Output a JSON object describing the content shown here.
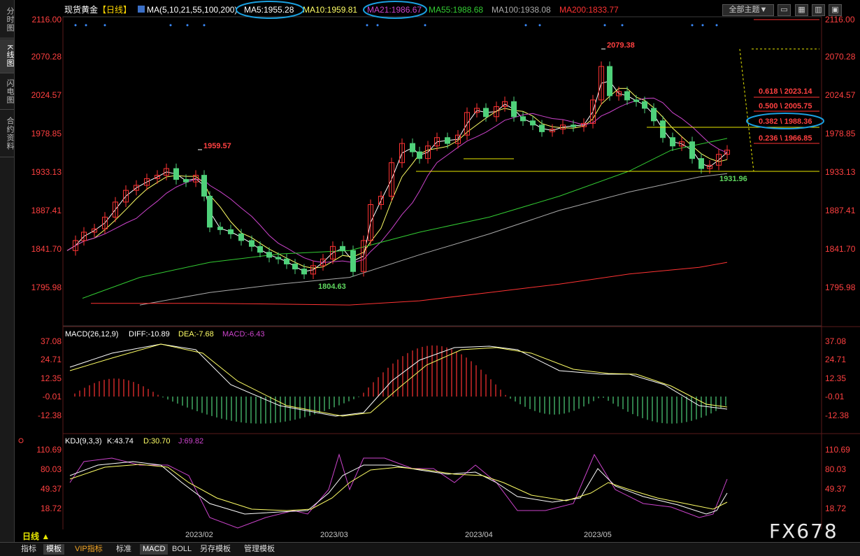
{
  "sidebar": {
    "items": [
      {
        "label": "分时图",
        "active": false
      },
      {
        "label": "K线图",
        "active": true
      },
      {
        "label": "闪电图",
        "active": false
      },
      {
        "label": "合约资料",
        "active": false
      }
    ]
  },
  "header": {
    "symbol": "现货黄金",
    "period_tag": "【日线】",
    "ma_params": "MA(5,10,21,55,100,200)",
    "ma5": "MA5:1955.28",
    "ma10": "MA10:1959.81",
    "ma21": "MA21:1986.67",
    "ma55": "MA55:1988.68",
    "ma100": "MA100:1938.08",
    "ma200": "MA200:1833.77",
    "theme_button": "全部主题▼",
    "colors": {
      "ma5": "#ffffff",
      "ma10": "#ffff66",
      "ma21": "#cc44cc",
      "ma55": "#33cc33",
      "ma100": "#aaaaaa",
      "ma200": "#ff3333"
    }
  },
  "price_axis": {
    "ticks": [
      "2116.00",
      "2070.28",
      "2024.57",
      "1978.85",
      "1933.13",
      "1887.41",
      "1841.70",
      "1795.98"
    ]
  },
  "annotations": {
    "high_label": "2079.38",
    "peak1_label": "1959.57",
    "low_label": "1804.63",
    "recent_low_label": "1931.96",
    "fib": [
      "0.618 \\ 2023.14",
      "0.500 \\ 2005.75",
      "0.382 \\ 1988.36",
      "0.236 \\ 1966.85"
    ]
  },
  "macd": {
    "title": "MACD(26,12,9)",
    "diff": "DIFF:-10.89",
    "dea": "DEA:-7.68",
    "macd": "MACD:-6.43",
    "ticks": [
      "37.08",
      "24.71",
      "12.35",
      "-0.01",
      "-12.38"
    ]
  },
  "kdj": {
    "title": "KDJ(9,3,3)",
    "k": "K:43.74",
    "d": "D:30.70",
    "j": "J:69.82",
    "ticks": [
      "110.69",
      "80.03",
      "49.37",
      "18.72"
    ]
  },
  "x_axis": {
    "dates": [
      "2023/02",
      "2023/03",
      "2023/04",
      "2023/05"
    ]
  },
  "bottom": {
    "period_label": "日线 ▲",
    "tabs": [
      "指标",
      "模板",
      "VIP指标",
      "标准",
      "MACD",
      "BOLL",
      "另存模板",
      "管理模板"
    ]
  },
  "watermark": "FX678",
  "chart_data": {
    "type": "line",
    "title": "现货黄金【日线】",
    "ylim": [
      1795.98,
      2116.0
    ],
    "series": [
      {
        "name": "MA5",
        "color": "#ffffff",
        "last": 1955.28
      },
      {
        "name": "MA10",
        "color": "#ffff66",
        "last": 1959.81
      },
      {
        "name": "MA21",
        "color": "#cc44cc",
        "last": 1986.67
      },
      {
        "name": "MA55",
        "color": "#33cc33",
        "last": 1988.68
      },
      {
        "name": "MA100",
        "color": "#aaaaaa",
        "last": 1938.08
      },
      {
        "name": "MA200",
        "color": "#ff3333",
        "last": 1833.77
      }
    ],
    "fib_levels": [
      2023.14,
      2005.75,
      1988.36,
      1966.85
    ],
    "macd_values": {
      "DIFF": -10.89,
      "DEA": -7.68,
      "MACD": -6.43
    },
    "kdj_values": {
      "K": 43.74,
      "D": 30.7,
      "J": 69.82
    }
  }
}
